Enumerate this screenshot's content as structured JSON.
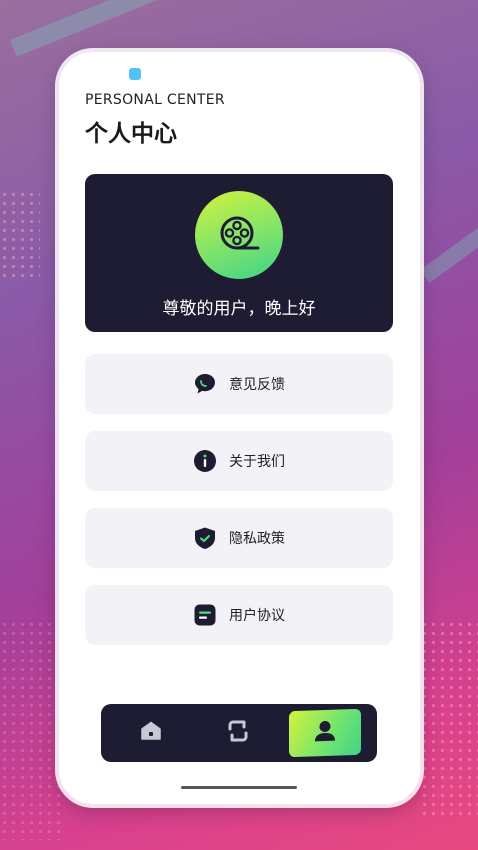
{
  "header": {
    "eyebrow": "PERSONAL CENTER",
    "title": "个人中心"
  },
  "hero": {
    "icon": "film-reel-icon",
    "greeting": "尊敬的用户，晚上好"
  },
  "menu": [
    {
      "label": "意见反馈",
      "icon": "chat-bubble-icon"
    },
    {
      "label": "关于我们",
      "icon": "info-icon"
    },
    {
      "label": "隐私政策",
      "icon": "shield-icon"
    },
    {
      "label": "用户协议",
      "icon": "document-icon"
    }
  ],
  "tabbar": {
    "tabs": [
      {
        "icon": "home-icon",
        "active": false
      },
      {
        "icon": "exchange-icon",
        "active": false
      },
      {
        "icon": "user-icon",
        "active": true
      }
    ]
  },
  "colors": {
    "dark": "#1d1c33",
    "accent_start": "#d4f23c",
    "accent_end": "#3fd388",
    "card_bg": "#f3f3f7"
  }
}
